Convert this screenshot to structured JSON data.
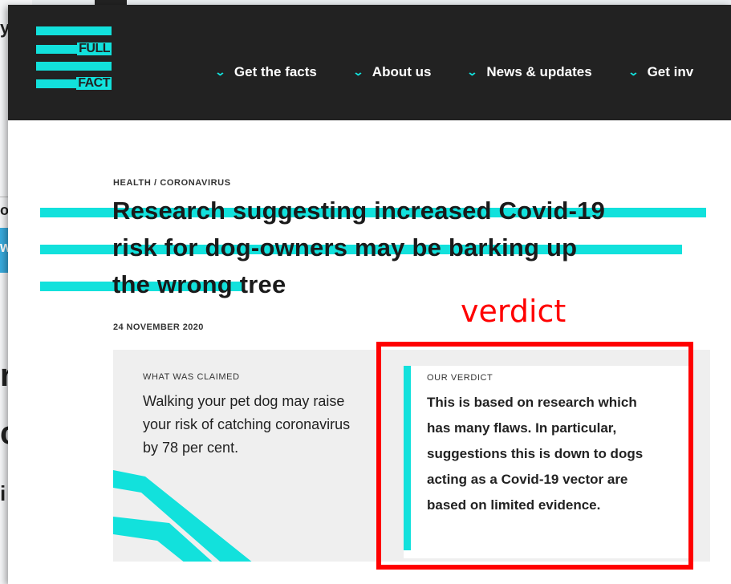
{
  "background_fragments": [
    "y",
    "o",
    "w",
    "r",
    "c",
    "i"
  ],
  "logo": {
    "line1": "FULL",
    "line2": "FACT"
  },
  "nav": [
    {
      "label": "Get the facts"
    },
    {
      "label": "About us"
    },
    {
      "label": "News & updates"
    },
    {
      "label": "Get inv"
    }
  ],
  "article": {
    "breadcrumb": "HEALTH / CORONAVIRUS",
    "title_lines": [
      "Research suggesting increased Covid-19",
      "risk for dog-owners may be barking up",
      "the wrong tree"
    ],
    "date": "24 NOVEMBER 2020"
  },
  "claim": {
    "label": "WHAT WAS CLAIMED",
    "text": "Walking your pet dog may raise your risk of catching coronavirus by 78 per cent."
  },
  "verdict": {
    "label": "OUR VERDICT",
    "text": "This is based on research which has many flaws. In particular, suggestions this is down to dogs acting as a Covid-19 vector are based on limited evidence."
  },
  "annotation": {
    "label": "verdict",
    "color": "#ff0000"
  },
  "colors": {
    "header": "#222222",
    "accent": "#12e1dc",
    "annotation": "#ff0000",
    "panel": "#efefef"
  }
}
